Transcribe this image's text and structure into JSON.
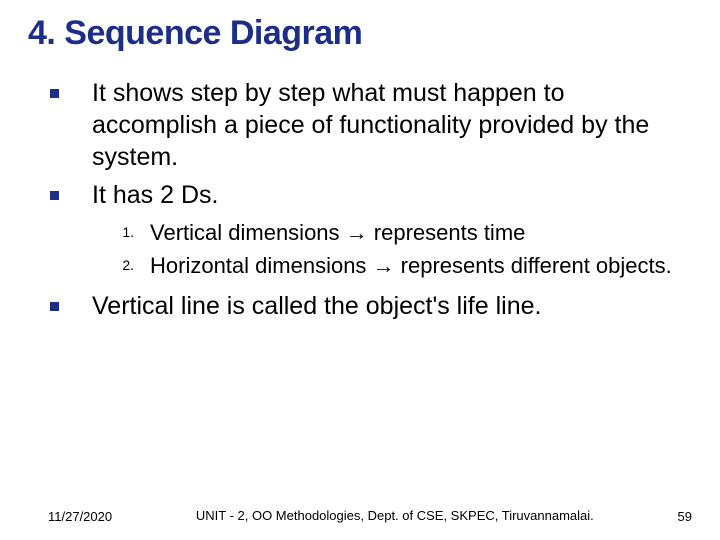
{
  "title": "4. Sequence Diagram",
  "bullets": {
    "b1": "It shows step by step what must happen to accomplish a piece of functionality provided by the system.",
    "b2": "It has 2 Ds.",
    "b3": "Vertical line is called the object's life line."
  },
  "numbered": {
    "n1_num": "1.",
    "n1_a": "Vertical dimensions ",
    "n1_b": " represents time",
    "n2_num": "2.",
    "n2_a": "Horizontal dimensions ",
    "n2_b": " represents different objects."
  },
  "arrow": "→",
  "footer": {
    "date": "11/27/2020",
    "center": "UNIT - 2, OO Methodologies, Dept. of CSE, SKPEC, Tiruvannamalai.",
    "page": "59"
  }
}
